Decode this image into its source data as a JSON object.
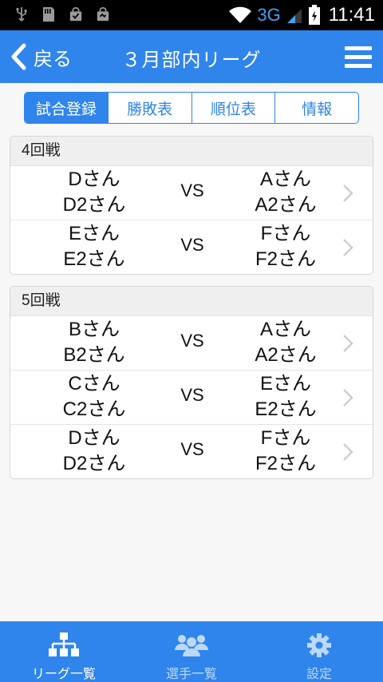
{
  "status_bar": {
    "network": "3G",
    "time": "11:41",
    "icons": [
      "usb-icon",
      "sd-card-icon",
      "shopping-bag-icon",
      "shopping-bag-check-icon",
      "wifi-icon",
      "signal-icon",
      "battery-icon"
    ]
  },
  "header": {
    "back_label": "戻る",
    "title": "３月部内リーグ",
    "menu_icon": "hamburger-menu-icon"
  },
  "tabs": [
    {
      "label": "試合登録",
      "active": true
    },
    {
      "label": "勝敗表",
      "active": false
    },
    {
      "label": "順位表",
      "active": false
    },
    {
      "label": "情報",
      "active": false
    }
  ],
  "rounds": [
    {
      "title": "4回戦",
      "matches": [
        {
          "left": [
            "Dさん",
            "D2さん"
          ],
          "vs": "VS",
          "right": [
            "Aさん",
            "A2さん"
          ]
        },
        {
          "left": [
            "Eさん",
            "E2さん"
          ],
          "vs": "VS",
          "right": [
            "Fさん",
            "F2さん"
          ]
        }
      ]
    },
    {
      "title": "5回戦",
      "matches": [
        {
          "left": [
            "Bさん",
            "B2さん"
          ],
          "vs": "VS",
          "right": [
            "Aさん",
            "A2さん"
          ]
        },
        {
          "left": [
            "Cさん",
            "C2さん"
          ],
          "vs": "VS",
          "right": [
            "Eさん",
            "E2さん"
          ]
        },
        {
          "left": [
            "Dさん",
            "D2さん"
          ],
          "vs": "VS",
          "right": [
            "Fさん",
            "F2さん"
          ]
        }
      ]
    }
  ],
  "bottom_nav": [
    {
      "label": "リーグ一覧",
      "icon": "org-chart-icon",
      "active": true
    },
    {
      "label": "選手一覧",
      "icon": "players-group-icon",
      "active": false
    },
    {
      "label": "設定",
      "icon": "gear-icon",
      "active": false
    }
  ],
  "colors": {
    "primary": "#2f85ec",
    "nav_inactive_text": "#bcd8fa",
    "section_header_bg": "#efefef",
    "background": "#f7f7f7"
  }
}
